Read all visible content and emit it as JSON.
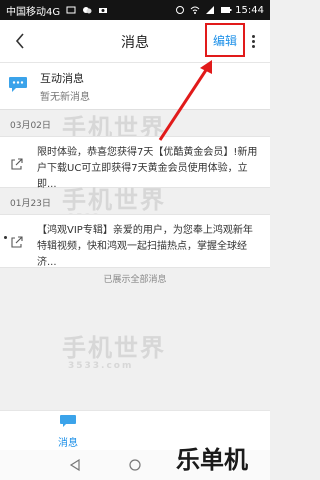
{
  "status_bar": {
    "carrier": "中国移动4G",
    "time": "15:44"
  },
  "header": {
    "title": "消息",
    "edit_label": "编辑"
  },
  "interactive": {
    "name": "互动消息",
    "status": "暂无新消息"
  },
  "sections": [
    {
      "date": "03月02日",
      "text": "限时体验，恭喜您获得7天【优酷黄金会员】!新用户下载UC可立即获得7天黄金会员使用体验，立即..."
    },
    {
      "date": "01月23日",
      "text": "【鸿观VIP专辑】亲爱的用户，为您奉上鸿观新年特辑视频，快和鸿观一起扫描热点，掌握全球经济..."
    }
  ],
  "load_more": "已展示全部消息",
  "watermark": {
    "name": "手机世界",
    "domain": "3533.com"
  },
  "bottom_tab": {
    "label": "消息"
  },
  "brand": "乐单机",
  "colors": {
    "accent": "#1b8fe8",
    "annotation_red": "#e11a1a"
  }
}
